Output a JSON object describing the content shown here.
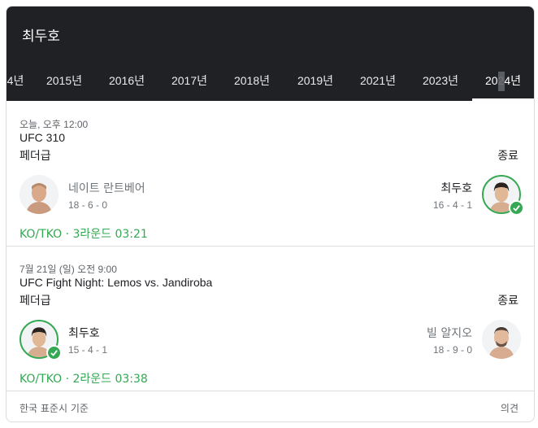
{
  "title": "최두호",
  "tabs": [
    "4년",
    "2015년",
    "2016년",
    "2017년",
    "2018년",
    "2019년",
    "2021년",
    "2023년",
    "2024년"
  ],
  "active_tab": "2024년",
  "matches": [
    {
      "time": "오늘, 오후 12:00",
      "event": "UFC 310",
      "weight_class": "페더급",
      "status": "종료",
      "left": {
        "name": "네이트 란트베어",
        "record": "18 - 6 - 0",
        "winner": false
      },
      "right": {
        "name": "최두호",
        "record": "16 - 4 - 1",
        "winner": true
      },
      "result": "KO/TKO · 3라운드 03:21"
    },
    {
      "time": "7월 21일 (일) 오전 9:00",
      "event": "UFC Fight Night: Lemos vs. Jandiroba",
      "weight_class": "페더급",
      "status": "종료",
      "left": {
        "name": "최두호",
        "record": "15 - 4 - 1",
        "winner": true
      },
      "right": {
        "name": "빌 알지오",
        "record": "18 - 9 - 0",
        "winner": false
      },
      "result": "KO/TKO · 2라운드 03:38"
    }
  ],
  "footer": {
    "timezone": "한국 표준시 기준",
    "feedback": "의견"
  },
  "colors": {
    "header": "#202124",
    "accent_green": "#34a853",
    "divider": "#dadce0"
  }
}
